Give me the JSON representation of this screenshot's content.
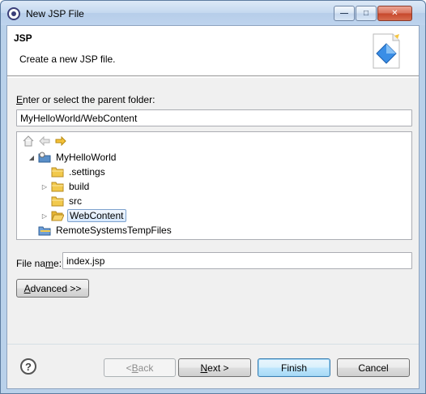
{
  "window": {
    "title": "New JSP File",
    "minimize_glyph": "—",
    "maximize_glyph": "□",
    "close_glyph": "✕"
  },
  "header": {
    "title": "JSP",
    "description": "Create a new JSP file."
  },
  "parent_folder": {
    "label_accel": "E",
    "label_rest": "nter or select the parent folder:",
    "value": "MyHelloWorld/WebContent"
  },
  "tree": {
    "items": [
      {
        "label": "MyHelloWorld",
        "icon": "project-icon",
        "expand": "expanded"
      },
      {
        "label": ".settings",
        "icon": "folder-icon",
        "expand": "none"
      },
      {
        "label": "build",
        "icon": "folder-icon",
        "expand": "collapsed"
      },
      {
        "label": "src",
        "icon": "folder-icon",
        "expand": "none"
      },
      {
        "label": "WebContent",
        "icon": "folder-open-icon",
        "expand": "collapsed",
        "selected": true
      },
      {
        "label": "RemoteSystemsTempFiles",
        "icon": "project-folder-icon",
        "expand": "none"
      }
    ]
  },
  "file_name": {
    "label_pre": "File na",
    "label_accel": "m",
    "label_post": "e:",
    "value": "index.jsp"
  },
  "buttons": {
    "advanced_accel": "A",
    "advanced_rest": "dvanced >>",
    "back_pre": "< ",
    "back_accel": "B",
    "back_rest": "ack",
    "next_accel": "N",
    "next_rest": "ext >",
    "finish": "Finish",
    "cancel": "Cancel"
  },
  "help": {
    "glyph": "?"
  },
  "colors": {
    "title_bar": "#c4d8ef",
    "dialog_bg": "#f0f0f0",
    "folder_yellow": "#f2c94c",
    "selection_border": "#7da2ce"
  }
}
